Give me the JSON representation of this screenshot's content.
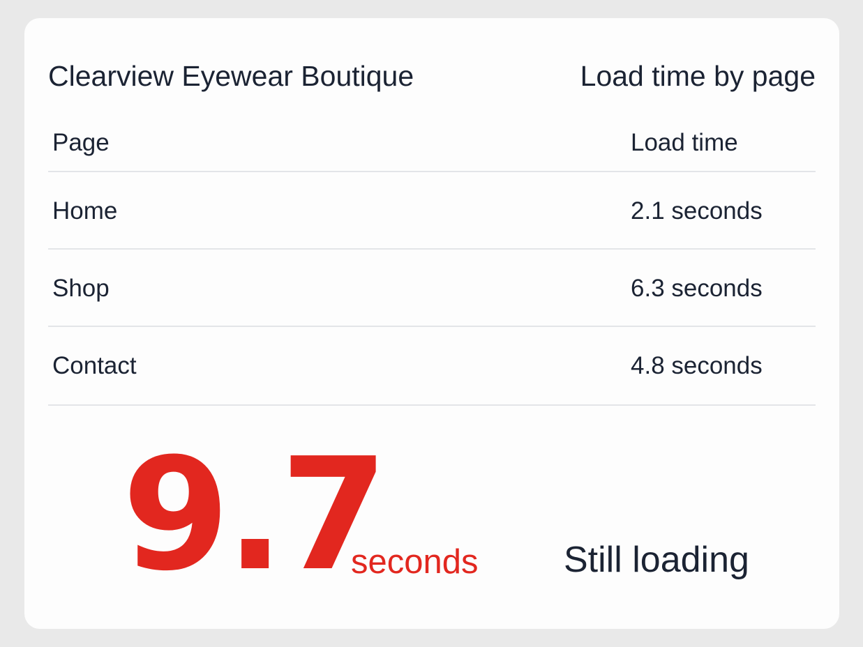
{
  "header": {
    "site_name": "Clearview Eyewear Boutique",
    "section_title": "Load time by page"
  },
  "table": {
    "columns": [
      "Page",
      "Load time"
    ],
    "rows": [
      {
        "page": "Home",
        "load_time": "2.1 seconds"
      },
      {
        "page": "Shop",
        "load_time": "6.3 seconds"
      },
      {
        "page": "Contact",
        "load_time": "4.8 seconds"
      }
    ]
  },
  "highlight": {
    "value": "9.7",
    "unit": "seconds",
    "status": "Still loading"
  },
  "colors": {
    "accent": "#e2271f",
    "text": "#1b2333",
    "background": "#e9e9e9",
    "card": "#fdfdfd",
    "divider": "#e3e5e8"
  }
}
